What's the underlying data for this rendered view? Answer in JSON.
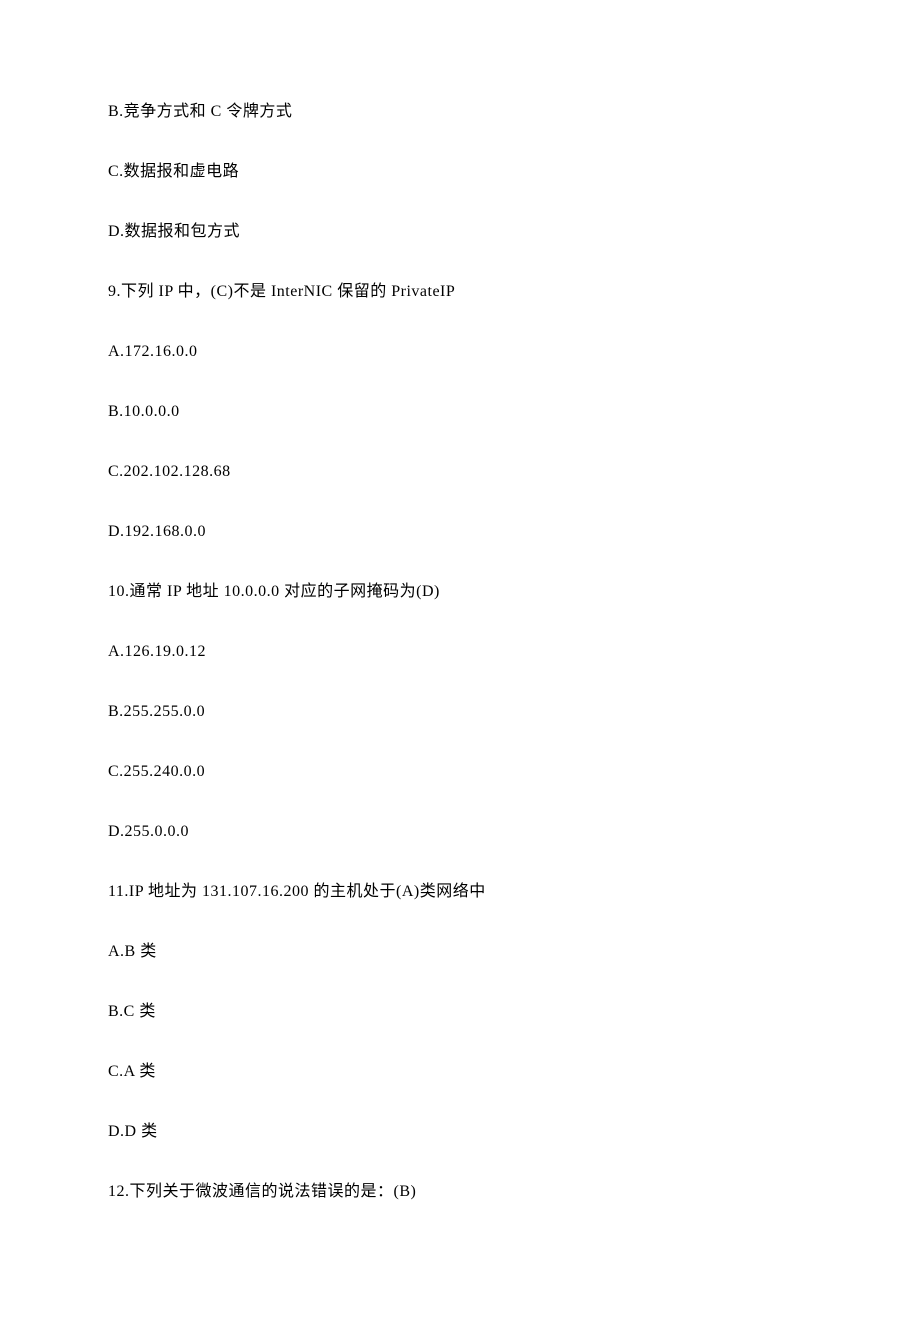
{
  "lines": {
    "q8_b": "B.竞争方式和 C 令牌方式",
    "q8_c": "C.数据报和虚电路",
    "q8_d": "D.数据报和包方式",
    "q9": "9.下列 IP 中，(C)不是 InterNIC 保留的 PrivateIP",
    "q9_a": "A.172.16.0.0",
    "q9_b": "B.10.0.0.0",
    "q9_c": "C.202.102.128.68",
    "q9_d": "D.192.168.0.0",
    "q10": "10.通常 IP 地址 10.0.0.0 对应的子网掩码为(D)",
    "q10_a": "A.126.19.0.12",
    "q10_b": "B.255.255.0.0",
    "q10_c": "C.255.240.0.0",
    "q10_d": "D.255.0.0.0",
    "q11": "11.IP 地址为 131.107.16.200 的主机处于(A)类网络中",
    "q11_a": "A.B 类",
    "q11_b": "B.C 类",
    "q11_c": "C.A 类",
    "q11_d": "D.D 类",
    "q12": "12.下列关于微波通信的说法错误的是：(B)"
  }
}
